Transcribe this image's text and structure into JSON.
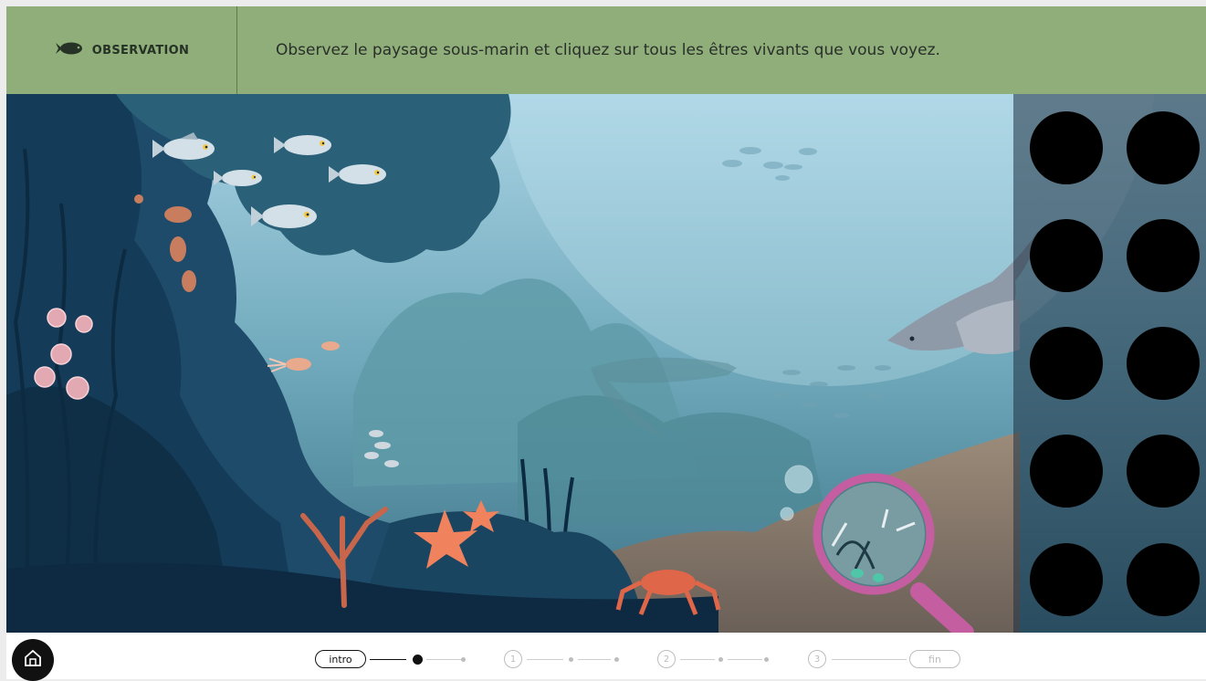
{
  "header": {
    "activity_icon": "fish-icon",
    "activity_label": "OBSERVATION",
    "instruction": "Observez le paysage sous-marin et cliquez sur tous les êtres vivants que vous voyez."
  },
  "scene": {
    "description_icon": "underwater-scene",
    "magnifier_icon": "magnifying-glass-icon"
  },
  "slots": {
    "count": 10,
    "color": "#000000"
  },
  "footer": {
    "home_icon": "home-icon",
    "steps": {
      "intro": "intro",
      "n1": "1",
      "n2": "2",
      "n3": "3",
      "fin": "fin"
    }
  },
  "colors": {
    "header_bg": "#8fae7a",
    "active_step": "#111111",
    "inactive_step": "#bdbdbd"
  }
}
